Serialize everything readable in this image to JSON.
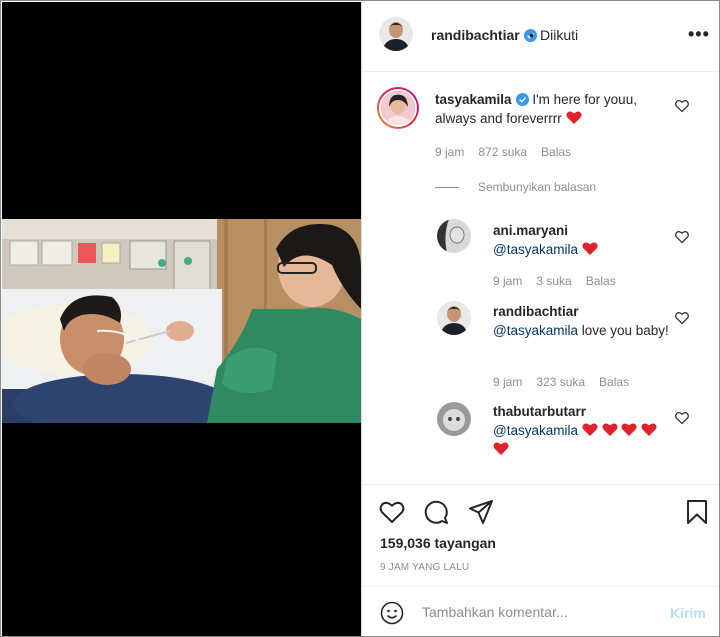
{
  "post_author": {
    "username": "randibachtiar",
    "dot": "•",
    "follow_status": "Diikuti"
  },
  "comments": [
    {
      "username": "tasyakamila",
      "text": "I'm here for youu, always and foreverrrr",
      "time": "9 jam",
      "likes": "872 suka",
      "reply": "Balas"
    }
  ],
  "hide_replies": "Sembunyikan balasan",
  "replies": [
    {
      "username": "ani.maryani",
      "mention": "@tasyakamila",
      "text": "",
      "time": "9 jam",
      "likes": "3 suka",
      "reply": "Balas"
    },
    {
      "username": "randibachtiar",
      "mention": "@tasyakamila",
      "text": "love you baby!",
      "time": "9 jam",
      "likes": "323 suka",
      "reply": "Balas"
    },
    {
      "username": "thabutarbutarr",
      "mention": "@tasyakamila",
      "text": ""
    }
  ],
  "stats": {
    "views": "159,036 tayangan",
    "time_ago": "9 JAM YANG LALU"
  },
  "comment_box": {
    "placeholder": "Tambahkan komentar...",
    "send_label": "Kirim"
  },
  "colors": {
    "verified": "#3897f0",
    "heart_red": "#ed4956",
    "link": "#00376b",
    "muted": "#8e8e8e",
    "send_disabled": "#b2dffc"
  },
  "icons": [
    "more-icon",
    "verified-icon",
    "heart-icon",
    "comment-icon",
    "share-icon",
    "bookmark-icon",
    "emoji-icon"
  ]
}
